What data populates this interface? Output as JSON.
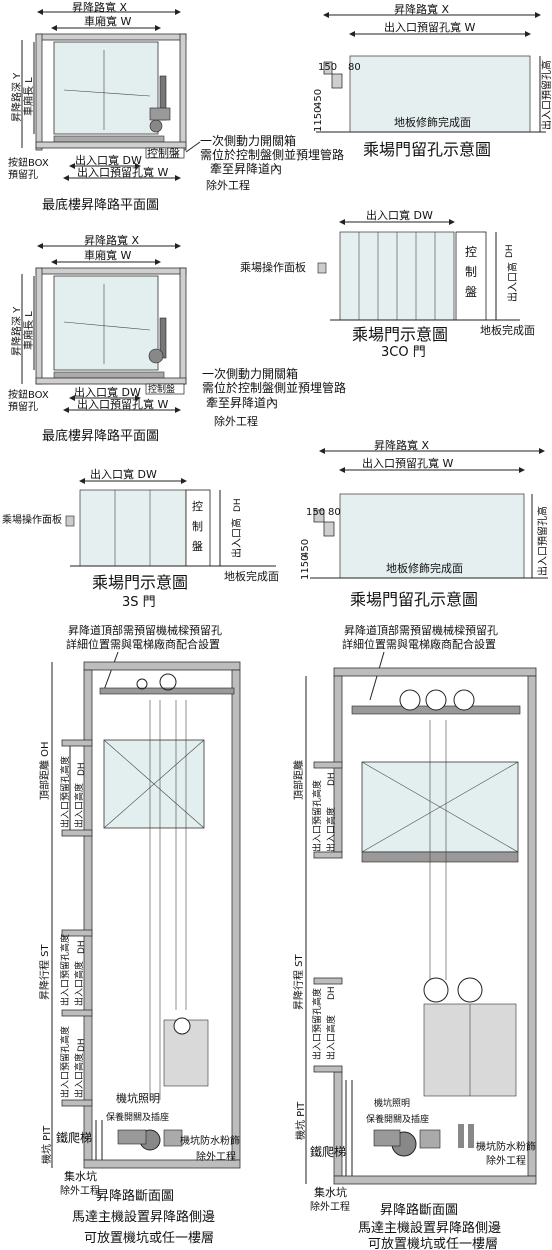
{
  "plan_view": {
    "hoistway_width": "昇降路寬 X",
    "car_width": "車廂寬 W",
    "hoistway_depth": "昇降路深 Y",
    "car_depth": "車廂長 L",
    "button_box": "按鈕BOX",
    "button_box_hole": "預留孔",
    "entrance_width": "出入口寬 DW",
    "entrance_hole_width": "出入口預留孔寬 W",
    "control_panel": "控制盤",
    "note_line1": "一次側動力開關箱",
    "note_line2": "需位於控制盤側並預埋管路",
    "note_line3": "牽至昇降道內",
    "excluded": "除外工程",
    "title": "最底樓昇降路平面圖"
  },
  "hole_view": {
    "hoistway_width": "昇降路寬  X",
    "hole_width": "出入口預留孔寬  W",
    "dim_150": "150",
    "dim_80": "80",
    "dim_450": "450",
    "dim_1150": "1150",
    "hole_height": "出入口預留孔高",
    "floor_finish": "地板修飾完成面",
    "title": "乘場門留孔示意圖"
  },
  "door_3co": {
    "entrance_width": "出入口寬  DW",
    "hall_panel": "乘場操作面板",
    "control": [
      "控",
      "制",
      "盤"
    ],
    "entrance_height": "出入口高",
    "dh": "DH",
    "floor_finish": "地板完成面",
    "title": "乘場門示意圖",
    "subtitle": "3CO 門"
  },
  "door_3s": {
    "entrance_width": "出入口寬  DW",
    "hall_panel": "乘場操作面板",
    "control": [
      "控",
      "制",
      "盤"
    ],
    "entrance_height": "出入口高",
    "dh": "DH",
    "floor_finish": "地板完成面",
    "title": "乘場門示意圖",
    "subtitle": "3S 門"
  },
  "section_left": {
    "note_line1": "昇降道頂部需預留機械樑預留孔",
    "note_line2": "詳細位置需與電梯廠商配合設置",
    "overhead": "頂部距離  OH",
    "travel": "昇降行程  ST",
    "hole_height": "出入口預留孔高度",
    "entrance_height": "出入口高度",
    "dh": "DH",
    "pit": "機坑  PIT",
    "pit_light": "機坑照明",
    "safety_switch": "保養開關及插座",
    "ladder": "鐵爬梯",
    "waterproof": "機坑防水粉飾",
    "sump": "集水坑",
    "excluded": "除外工程",
    "title": "昇降路斷面圖",
    "caption1": "馬達主機設置昇降路側邊",
    "caption2": "可放置機坑或任一樓層"
  },
  "section_right": {
    "note_line1": "昇降道頂部需預留機械樑預留孔",
    "note_line2": "詳細位置需與電梯廠商配合設置",
    "overhead": "頂部距離",
    "travel": "昇降行程  ST",
    "hole_height": "出入口預留孔高度",
    "entrance_height": "出入口高度",
    "dh": "DH",
    "pit": "機坑  PIT",
    "pit_light": "機坑照明",
    "safety_switch": "保養開關及插座",
    "ladder": "鐵爬梯",
    "waterproof": "機坑防水粉飾",
    "sump": "集水坑",
    "excluded": "除外工程",
    "title": "昇降路斷面圖",
    "caption1": "馬達主機設置昇降路側邊",
    "caption2": "可放置機坑或任一樓層"
  },
  "colors": {
    "line": "#222222",
    "wall_fill": "#cfcfcf",
    "car_fill": "#e3eeee"
  }
}
